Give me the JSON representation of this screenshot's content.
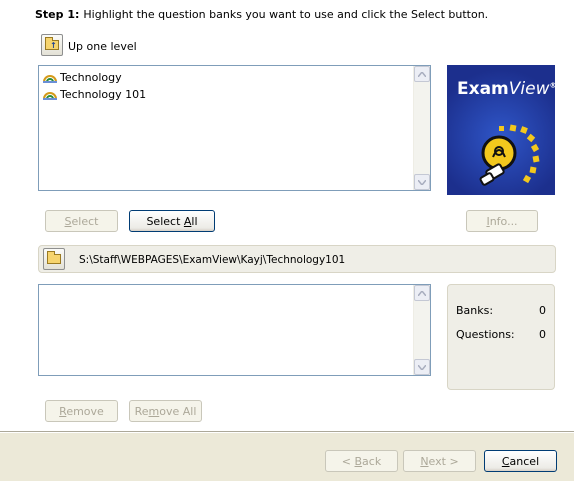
{
  "step": {
    "label": "Step 1:",
    "text": "Highlight the question banks you want to use and click the Select button."
  },
  "nav": {
    "up_label": "Up one level"
  },
  "banks": [
    {
      "name": "Technology"
    },
    {
      "name": "Technology 101"
    }
  ],
  "buttons": {
    "select": {
      "pre": "",
      "key": "S",
      "post": "elect"
    },
    "select_all": {
      "pre": "Select ",
      "key": "A",
      "post": "ll"
    },
    "info": {
      "pre": "",
      "key": "I",
      "post": "nfo..."
    },
    "remove": {
      "pre": "",
      "key": "R",
      "post": "emove"
    },
    "remove_all": {
      "pre": "Re",
      "key": "m",
      "post": "ove All"
    },
    "back": {
      "pre": "< ",
      "key": "B",
      "post": "ack"
    },
    "next": {
      "pre": "",
      "key": "N",
      "post": "ext >"
    },
    "cancel": {
      "pre": "",
      "key": "C",
      "post": "ancel"
    }
  },
  "logo": {
    "brand_bold": "Exam",
    "brand_italic": "View",
    "mark": "®"
  },
  "path": "S:\\Staff\\WEBPAGES\\ExamView\\Kayj\\Technology101",
  "stats": {
    "banks_label": "Banks:",
    "banks_value": "0",
    "questions_label": "Questions:",
    "questions_value": "0"
  },
  "colors": {
    "logo_blue": "#1c2f8d",
    "button_border": "#003c74",
    "disabled_text": "#aca899",
    "dialog_bg": "#ece9d8"
  },
  "icons": {
    "up": "folder-up-icon",
    "bank": "question-bank-icon",
    "path": "open-folder-icon",
    "logo": "lightbulb-icon"
  }
}
